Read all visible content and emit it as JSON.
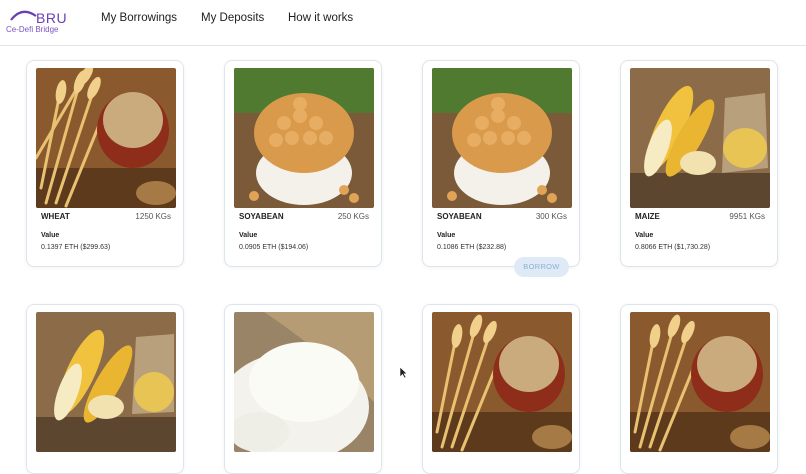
{
  "brand": {
    "title": "BRU",
    "subtitle": "Ce-Defi Bridge"
  },
  "nav": [
    "My Borrowings",
    "My Deposits",
    "How it works"
  ],
  "value_label": "Value",
  "borrow_label": "BORROW",
  "cards": [
    {
      "name": "WHEAT",
      "qty": "1250 KGs",
      "value": "0.1397 ETH ($299.63)",
      "image": "wheat-image"
    },
    {
      "name": "SOYABEAN",
      "qty": "250 KGs",
      "value": "0.0905 ETH ($194.06)",
      "image": "soyabean-image"
    },
    {
      "name": "SOYABEAN",
      "qty": "300 KGs",
      "value": "0.1086 ETH ($232.88)",
      "image": "soyabean-image"
    },
    {
      "name": "MAIZE",
      "qty": "9951 KGs",
      "value": "0.8066 ETH ($1,730.28)",
      "image": "maize-image"
    },
    {
      "name": "",
      "qty": "",
      "value": "",
      "image": "maize-image"
    },
    {
      "name": "",
      "qty": "",
      "value": "",
      "image": "rice-image"
    },
    {
      "name": "",
      "qty": "",
      "value": "",
      "image": "wheat-image"
    },
    {
      "name": "",
      "qty": "",
      "value": "",
      "image": "wheat-image"
    }
  ],
  "colors": {
    "brand": "#6a3fb5",
    "borrow_bg": "#dfeaf6",
    "borrow_text": "#8bb1d8",
    "card_border": "#dde5ec"
  }
}
